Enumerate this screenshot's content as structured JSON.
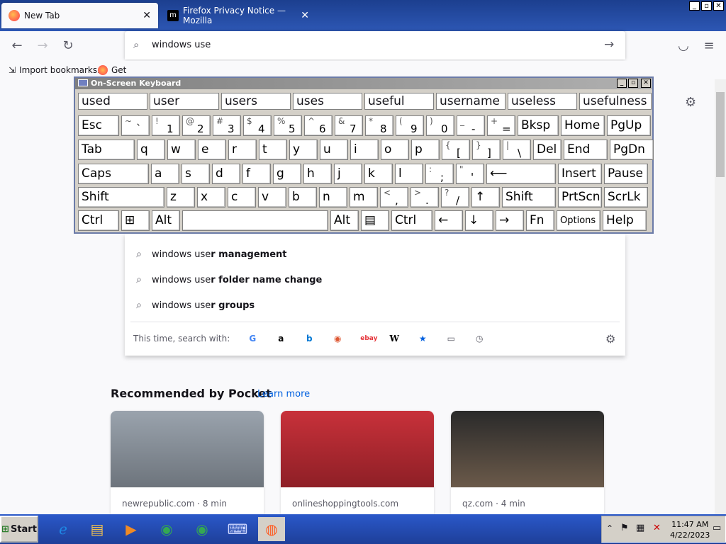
{
  "browser": {
    "tabs": [
      {
        "title": "New Tab",
        "active": true
      },
      {
        "title": "Firefox Privacy Notice — Mozilla",
        "active": false
      }
    ],
    "url_input": "windows use",
    "bookmarks": [
      "Import bookmarks...",
      "Get"
    ]
  },
  "suggestions": [
    {
      "typed": "windows use",
      "rest": "r management"
    },
    {
      "typed": "windows use",
      "rest": "r folder name change"
    },
    {
      "typed": "windows use",
      "rest": "r groups"
    }
  ],
  "search_with_label": "This time, search with:",
  "engines": [
    "google-icon",
    "amazon-icon",
    "bing-icon",
    "duckduckgo-icon",
    "ebay-icon",
    "wikipedia-icon",
    "bookmarks-icon",
    "tabs-icon",
    "history-icon"
  ],
  "pocket": {
    "heading": "Recommended by Pocket",
    "learn_more": "Learn more",
    "cards": [
      {
        "source": "newrepublic.com · 8 min"
      },
      {
        "source": "onlineshoppingtools.com"
      },
      {
        "source": "qz.com · 4 min"
      }
    ]
  },
  "osk": {
    "title": "On-Screen Keyboard",
    "predictions": [
      "used",
      "user",
      "users",
      "uses",
      "useful",
      "username",
      "useless",
      "usefulness"
    ],
    "rows": [
      [
        {
          "l": "Esc",
          "w": 58
        },
        {
          "u": "~",
          "d": "`",
          "w": 40
        },
        {
          "u": "!",
          "d": "1",
          "w": 40
        },
        {
          "u": "@",
          "d": "2",
          "w": 40
        },
        {
          "u": "#",
          "d": "3",
          "w": 40
        },
        {
          "u": "$",
          "d": "4",
          "w": 40
        },
        {
          "u": "%",
          "d": "5",
          "w": 40
        },
        {
          "u": "^",
          "d": "6",
          "w": 40
        },
        {
          "u": "&",
          "d": "7",
          "w": 40
        },
        {
          "u": "*",
          "d": "8",
          "w": 40
        },
        {
          "u": "(",
          "d": "9",
          "w": 40
        },
        {
          "u": ")",
          "d": "0",
          "w": 40
        },
        {
          "u": "_",
          "d": "-",
          "w": 40
        },
        {
          "u": "+",
          "d": "=",
          "w": 40
        },
        {
          "l": "Bksp",
          "w": 58
        },
        {
          "l": "Home",
          "w": 62
        },
        {
          "l": "PgUp",
          "w": 62
        }
      ],
      [
        {
          "l": "Tab",
          "w": 80
        },
        {
          "l": "q",
          "w": 40
        },
        {
          "l": "w",
          "w": 40
        },
        {
          "l": "e",
          "w": 40
        },
        {
          "l": "r",
          "w": 40
        },
        {
          "l": "t",
          "w": 40
        },
        {
          "l": "y",
          "w": 40
        },
        {
          "l": "u",
          "w": 40
        },
        {
          "l": "i",
          "w": 40
        },
        {
          "l": "o",
          "w": 40
        },
        {
          "l": "p",
          "w": 40
        },
        {
          "u": "{",
          "d": "[",
          "w": 40
        },
        {
          "u": "}",
          "d": "]",
          "w": 40
        },
        {
          "u": "|",
          "d": "\\",
          "w": 40
        },
        {
          "l": "Del",
          "w": 40
        },
        {
          "l": "End",
          "w": 62
        },
        {
          "l": "PgDn",
          "w": 62
        }
      ],
      [
        {
          "l": "Caps",
          "w": 100
        },
        {
          "l": "a",
          "w": 40
        },
        {
          "l": "s",
          "w": 40
        },
        {
          "l": "d",
          "w": 40
        },
        {
          "l": "f",
          "w": 40
        },
        {
          "l": "g",
          "w": 40
        },
        {
          "l": "h",
          "w": 40
        },
        {
          "l": "j",
          "w": 40
        },
        {
          "l": "k",
          "w": 40
        },
        {
          "l": "l",
          "w": 40
        },
        {
          "u": ":",
          "d": ";",
          "w": 40
        },
        {
          "u": "\"",
          "d": "'",
          "w": 40
        },
        {
          "l": "⟵",
          "w": 98
        },
        {
          "l": "Insert",
          "w": 62
        },
        {
          "l": "Pause",
          "w": 62
        }
      ],
      [
        {
          "l": "Shift",
          "w": 122
        },
        {
          "l": "z",
          "w": 40
        },
        {
          "l": "x",
          "w": 40
        },
        {
          "l": "c",
          "w": 40
        },
        {
          "l": "v",
          "w": 40
        },
        {
          "l": "b",
          "w": 40
        },
        {
          "l": "n",
          "w": 40
        },
        {
          "l": "m",
          "w": 40
        },
        {
          "u": "<",
          "d": ",",
          "w": 40
        },
        {
          "u": ">",
          "d": ".",
          "w": 40
        },
        {
          "u": "?",
          "d": "/",
          "w": 40
        },
        {
          "l": "↑",
          "w": 40
        },
        {
          "l": "Shift",
          "w": 76
        },
        {
          "l": "PrtScn",
          "w": 62
        },
        {
          "l": "ScrLk",
          "w": 62
        }
      ],
      [
        {
          "l": "Ctrl",
          "w": 58
        },
        {
          "l": "⊞",
          "w": 40
        },
        {
          "l": "Alt",
          "w": 40
        },
        {
          "l": "",
          "w": 206
        },
        {
          "l": "Alt",
          "w": 40
        },
        {
          "l": "▤",
          "w": 40
        },
        {
          "l": "Ctrl",
          "w": 58
        },
        {
          "l": "←",
          "w": 40
        },
        {
          "l": "↓",
          "w": 40
        },
        {
          "l": "→",
          "w": 40
        },
        {
          "l": "Fn",
          "w": 40
        },
        {
          "l": "Options",
          "w": 62
        },
        {
          "l": "Help",
          "w": 62
        }
      ]
    ]
  },
  "taskbar": {
    "start": "Start",
    "apps": [
      "ie-icon",
      "explorer-icon",
      "media-icon",
      "chrome-icon",
      "chrome-icon",
      "osk-icon",
      "firefox-icon"
    ],
    "time": "11:47 AM",
    "date": "4/22/2023"
  },
  "colors": {
    "titlebar": "#1c3f8f",
    "accent": "#0060df",
    "taskbar": "#2a58c9"
  }
}
